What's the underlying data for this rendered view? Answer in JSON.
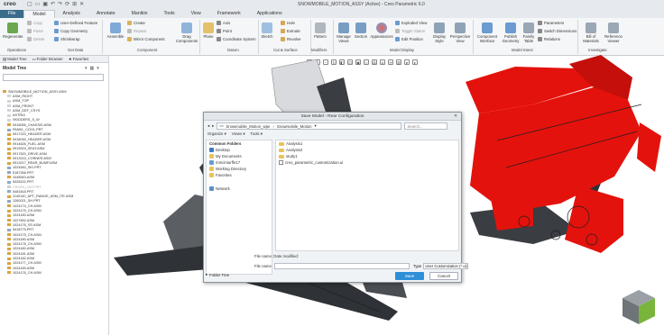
{
  "app": {
    "logo": "creo",
    "window_title": "SNOWMOBILE_MOTION_ASSY (Active) - Creo Parametric 6.0"
  },
  "colors": {
    "model_red": "#e4120c",
    "model_dark": "#3a3d41",
    "file_tab": "#3a6c8c",
    "save_button": "#2f8ed8",
    "folder": "#e8c35a"
  },
  "menu": {
    "tabs": [
      "File",
      "Model",
      "Analysis",
      "Annotate",
      "Manikin",
      "Tools",
      "View",
      "Framework",
      "Applications"
    ],
    "active": "Model"
  },
  "ribbon": {
    "regenerate": "Regenerate",
    "user_defined_feature": "User-Defined Feature",
    "copy_geometry": "Copy Geometry",
    "shrinkwrap": "Shrinkwrap",
    "copy": "Copy",
    "paste": "Paste",
    "delete": "Delete",
    "assemble": "Assemble",
    "create": "Create",
    "repeat": "Repeat",
    "mirror_component": "Mirror Component",
    "drag_components": "Drag Components",
    "plane": "Plane",
    "axis": "Axis",
    "point": "Point",
    "coordinate_system": "Coordinate System",
    "sketch": "Sketch",
    "hole": "Hole",
    "extrude": "Extrude",
    "revolve": "Revolve",
    "pattern": "Pattern",
    "manage_views": "Manage Views",
    "section": "Section",
    "appearances": "Appearances",
    "exploded_view": "Exploded View",
    "toggle_status": "Toggle Status",
    "edit_position": "Edit Position",
    "display_style": "Display Style",
    "perspective_view": "Perspective View",
    "component_interface": "Component Interface",
    "publish_geometry": "Publish Geometry",
    "family_table": "Family Table",
    "parameters": "Parameters",
    "switch_dimensions": "Switch Dimensions",
    "relations": "Relations",
    "bill_of_materials": "Bill of Materials",
    "reference_viewer": "Reference Viewer",
    "groups": {
      "operations": "Operations",
      "get_data": "Get Data",
      "component": "Component",
      "datum": "Datum",
      "cut_surface": "Cut & Surface",
      "modifiers": "Modifiers",
      "model_display": "Model Display",
      "model_intent": "Model Intent",
      "investigate": "Investigate"
    }
  },
  "nav": {
    "tabs": [
      "Model Tree",
      "Folder Browser",
      "Favorites"
    ],
    "tree_header": "Model Tree"
  },
  "tree": {
    "items": [
      {
        "label": "SNOWMOBILE_MOTION_ASSY.ASM",
        "kind": "asm"
      },
      {
        "label": "ASM_RIGHT",
        "kind": "datum"
      },
      {
        "label": "ASM_TOP",
        "kind": "datum"
      },
      {
        "label": "ASM_FRONT",
        "kind": "datum"
      },
      {
        "label": "ASM_DEF_CSYS",
        "kind": "datum"
      },
      {
        "label": "ASTRIO",
        "kind": "datum"
      },
      {
        "label": "SKIDDERS_S_W",
        "kind": "datum"
      },
      {
        "label": "0918055_CHASSIS.ASM",
        "kind": "asm"
      },
      {
        "label": "PANEL_COOL.PRT",
        "kind": "prt"
      },
      {
        "label": "0917220_HEADER.ASM",
        "kind": "asm"
      },
      {
        "label": "0918030_HEADER.ASM",
        "kind": "asm"
      },
      {
        "label": "0914626_FUEL.ASM",
        "kind": "asm"
      },
      {
        "label": "0919024_SEAT.ASM",
        "kind": "asm"
      },
      {
        "label": "0917520_DRIVE.ASM",
        "kind": "asm"
      },
      {
        "label": "0913215_CORNER.ASM",
        "kind": "asm"
      },
      {
        "label": "0913217_REAR_BUMP.ASM",
        "kind": "asm"
      },
      {
        "label": "1024540_SKI.PRT",
        "kind": "prt"
      },
      {
        "label": "5187266.PRT",
        "kind": "prt"
      },
      {
        "label": "1048540.ASM",
        "kind": "asm"
      },
      {
        "label": "5428222.PRT",
        "kind": "prt"
      },
      {
        "label": "CROSS_OUT.PRT",
        "kind": "grey"
      },
      {
        "label": "5481818.PRT",
        "kind": "prt"
      },
      {
        "label": "1140140_APT_RANGE_ASM_ITE.ASM",
        "kind": "asm"
      },
      {
        "label": "1260021_SH.PRT",
        "kind": "prt"
      },
      {
        "label": "1024174_CH.ASM",
        "kind": "asm"
      },
      {
        "label": "1024175_CH.ASM",
        "kind": "asm"
      },
      {
        "label": "1024180.ASM",
        "kind": "asm"
      },
      {
        "label": "1027892.ASM",
        "kind": "asm"
      },
      {
        "label": "1024176_SS.ASM",
        "kind": "asm"
      },
      {
        "label": "5418775.PRT",
        "kind": "prt"
      },
      {
        "label": "1024175_CH.ASM",
        "kind": "asm"
      },
      {
        "label": "1024180.ASM",
        "kind": "asm"
      },
      {
        "label": "1024178_CH.ASM",
        "kind": "asm"
      },
      {
        "label": "1024180.ASM",
        "kind": "asm"
      },
      {
        "label": "1024181.ASM",
        "kind": "asm"
      },
      {
        "label": "1024182.ASM",
        "kind": "asm"
      },
      {
        "label": "1024177_CH.ASM",
        "kind": "asm"
      },
      {
        "label": "1024183.ASM",
        "kind": "asm"
      },
      {
        "label": "1024176_CH.ASM",
        "kind": "asm"
      }
    ]
  },
  "dialog": {
    "title": "Save Model - Rear Configuration",
    "path": [
      "Snowmobile_Motion_wpe",
      "Snowmobile_Motion"
    ],
    "search_placeholder": "Search...",
    "organize": "Organize",
    "views": "Views",
    "tools": "Tools",
    "common_folders": "Common Folders",
    "left_items": [
      "Desktop",
      "My Documents",
      "mmcinturffe17",
      "Working Directory",
      "Favorites"
    ],
    "network": "Network",
    "files": [
      {
        "name": "Analysis1",
        "type": "folder"
      },
      {
        "name": "Analysis2",
        "type": "folder"
      },
      {
        "name": "study1",
        "type": "folder"
      },
      {
        "name": "creo_parametric_customization.ui",
        "type": "file"
      }
    ],
    "file_info": "File name:   Date modified:",
    "file_name_label": "File name",
    "type_label": "Type",
    "type_value": "User Customization (*.ui)",
    "folder_tree": "Folder Tree",
    "save": "Save",
    "cancel": "Cancel"
  }
}
